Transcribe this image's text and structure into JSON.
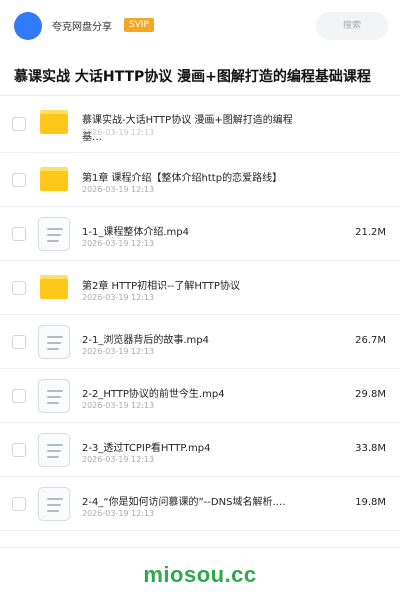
{
  "header": {
    "app_name": "夸克网盘分享",
    "badge": "SVIP",
    "search_placeholder": "搜索"
  },
  "share": {
    "title": "慕课实战 大话HTTP协议 漫画+图解打造的编程基础课程"
  },
  "files": [
    {
      "type": "folder",
      "name": "慕课实战-大话HTTP协议 漫画+图解打造的编程基…",
      "date": "2026-03-19 12:13",
      "size": ""
    },
    {
      "type": "folder",
      "name": "第1章 课程介绍【整体介绍http的恋爱路线】",
      "date": "2026-03-19 12:13",
      "size": ""
    },
    {
      "type": "file",
      "name": "1-1_课程整体介绍.mp4",
      "date": "2026-03-19 12:13",
      "size": "21.2M"
    },
    {
      "type": "folder",
      "name": "第2章 HTTP初相识--了解HTTP协议",
      "date": "2026-03-19 12:13",
      "size": ""
    },
    {
      "type": "file",
      "name": "2-1_浏览器背后的故事.mp4",
      "date": "2026-03-19 12:13",
      "size": "26.7M"
    },
    {
      "type": "file",
      "name": "2-2_HTTP协议的前世今生.mp4",
      "date": "2026-03-19 12:13",
      "size": "29.8M"
    },
    {
      "type": "file",
      "name": "2-3_透过TCPIP看HTTP.mp4",
      "date": "2026-03-19 12:13",
      "size": "33.8M"
    },
    {
      "type": "file",
      "name": "2-4_“你是如何访问慕课的”--DNS域名解析.…",
      "date": "2026-03-19 12:13",
      "size": "19.8M"
    }
  ],
  "watermark": "miosou.cc",
  "colors": {
    "avatar": "#2f7bf5",
    "badge": "#f5a623",
    "folder": "#ffc71a",
    "watermark": "#2ea84a"
  },
  "icons": {
    "folder": "folder-icon",
    "file": "video-file-icon"
  }
}
